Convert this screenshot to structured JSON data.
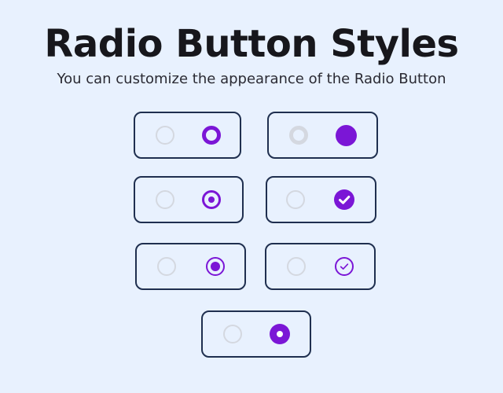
{
  "header": {
    "title": "Radio Button Styles",
    "subtitle": "You can customize the appearance of the Radio Button"
  },
  "colors": {
    "background": "#e8f1fe",
    "accent": "#7b16d6",
    "unchecked_border": "#d4d8e0",
    "card_border": "#1f2f4f"
  },
  "radio_groups": [
    {
      "style": "thick-ring",
      "options": [
        {
          "checked": false
        },
        {
          "checked": true
        }
      ]
    },
    {
      "style": "solid-filled",
      "options": [
        {
          "checked": false
        },
        {
          "checked": true
        }
      ]
    },
    {
      "style": "ring-with-dot",
      "options": [
        {
          "checked": false
        },
        {
          "checked": true
        }
      ]
    },
    {
      "style": "filled-check",
      "icon": "check-icon",
      "options": [
        {
          "checked": false
        },
        {
          "checked": true
        }
      ]
    },
    {
      "style": "ring-with-large-dot",
      "options": [
        {
          "checked": false
        },
        {
          "checked": true
        }
      ]
    },
    {
      "style": "outline-check",
      "icon": "check-icon",
      "options": [
        {
          "checked": false
        },
        {
          "checked": true
        }
      ]
    },
    {
      "style": "filled-hollow-center",
      "options": [
        {
          "checked": false
        },
        {
          "checked": true
        }
      ]
    }
  ]
}
